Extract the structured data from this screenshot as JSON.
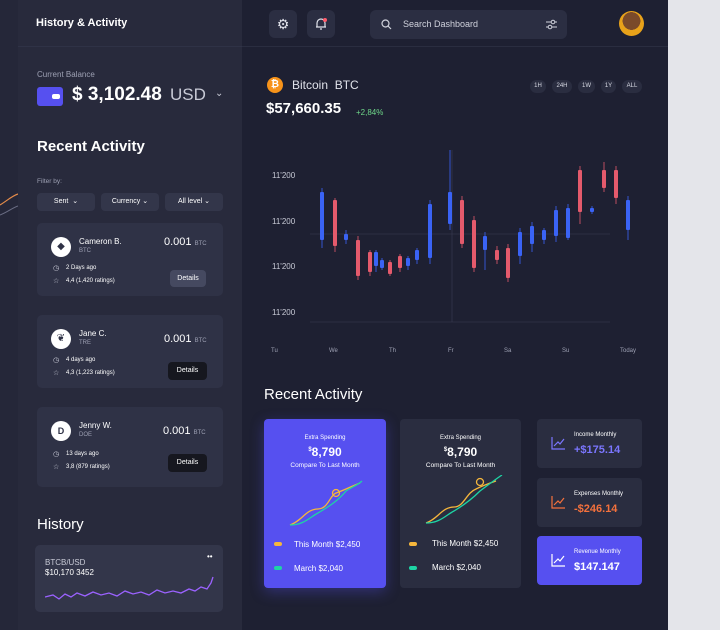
{
  "sidebar": {
    "title": "History & Activity",
    "balance_label": "Current Balance",
    "balance_amount": "$ 3,102.48",
    "balance_currency": "USD",
    "recent_title": "Recent Activity",
    "filter_label": "Filter by:",
    "filters": [
      "Sent",
      "Currency",
      "All level"
    ],
    "activities": [
      {
        "name": "Cameron B.",
        "code": "BTC",
        "amount": "0.001",
        "unit": "BTC",
        "time": "2 Days ago",
        "rating": "4,4 (1,420 ratings)",
        "button": "Details"
      },
      {
        "name": "Jane C.",
        "code": "TRE",
        "amount": "0.001",
        "unit": "BTC",
        "time": "4 days ago",
        "rating": "4,3 (1,223 ratings)",
        "button": "Details"
      },
      {
        "name": "Jenny W.",
        "code": "DOE",
        "amount": "0.001",
        "unit": "BTC",
        "time": "13 days ago",
        "rating": "3,8 (879 ratings)",
        "button": "Details"
      }
    ],
    "history_title": "History",
    "history_pair": "BTCB/USD",
    "history_value": "$10,170 3452"
  },
  "topbar": {
    "search_placeholder": "Search Dashboard"
  },
  "coin": {
    "name": "Bitcoin",
    "symbol": "BTC",
    "price": "$57,660.35",
    "change": "+2,84%",
    "timeframes": [
      "1H",
      "24H",
      "1W",
      "1Y",
      "ALL"
    ]
  },
  "chart_data": {
    "type": "candlestick",
    "y_tick_labels": [
      "11'200",
      "11'200",
      "11'200",
      "11'200"
    ],
    "x_tick_labels": [
      "Tu",
      "We",
      "Th",
      "Fr",
      "Sa",
      "Su",
      "Today"
    ]
  },
  "recent": {
    "title": "Recent Activity",
    "card1": {
      "label": "Extra Spending",
      "symbol": "$",
      "value": "8,790",
      "compare": "Compare To Last Month",
      "this_month": "This Month $2,450",
      "march": "March $2,040"
    },
    "card2": {
      "label": "Extra Spending",
      "symbol": "$",
      "value": "8,790",
      "compare": "Compare To Last Month",
      "this_month": "This Month $2,450",
      "march": "March $2,040"
    },
    "income": {
      "label": "Income Monthly",
      "value": "+$175.14"
    },
    "expenses": {
      "label": "Expenses Monthly",
      "value": "-$246.14"
    },
    "revenue": {
      "label": "Revenue Monthly",
      "value": "$147.147"
    }
  },
  "colors": {
    "accent": "#5650f0",
    "positive": "#6fd88a",
    "negative": "#f5713c",
    "bitcoin": "#f7931a"
  }
}
